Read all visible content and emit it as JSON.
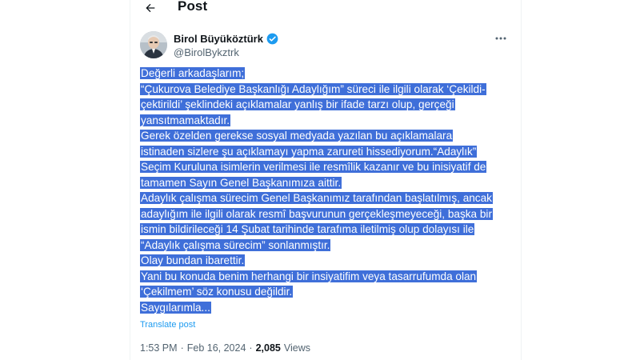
{
  "header": {
    "title": "Post"
  },
  "author": {
    "name": "Birol Büyüköztürk",
    "handle": "@BirolBykztrk"
  },
  "tweet": {
    "lines": [
      "Değerli arkadaşlarım;",
      "“Çukurova Belediye Başkanlığı Adaylığım” süreci ile ilgili olarak ‘Çekildi-",
      "çektirildi’ şeklindeki açıklamalar yanlış bir ifade tarzı olup, gerçeği",
      "yansıtmamaktadır.",
      "Gerek özelden gerekse sosyal medyada yazılan bu açıklamalara",
      "istinaden sizlere şu açıklamayı yapma zarureti hissediyorum.“Adaylık”",
      "Seçim Kuruluna isimlerin verilmesi ile resmîlik kazanır ve bu inisiyatif de",
      "tamamen Sayın Genel Başkanımıza aittir.",
      "Adaylık çalışma sürecim Genel Başkanımız tarafından başlatılmış, ancak",
      "adaylığım ile ilgili olarak resmî başvurunun gerçekleşmeyeceği, başka bir",
      "ismin bildirileceği 14 Şubat tarihinde tarafıma iletilmiş olup dolayısı ile",
      "“Adaylık çalışma sürecim” sonlanmıştır.",
      "Olay bundan ibarettir.",
      "Yani bu konuda benim herhangi bir insiyatifim veya tasarrufumda olan",
      "‘Çekilmem’ söz konusu değildir.",
      "Saygılarımla..."
    ],
    "translate_label": "Translate post"
  },
  "meta": {
    "time": "1:53 PM",
    "date": "Feb 16, 2024",
    "separator": "·",
    "views_count": "2,085",
    "views_label": "Views"
  },
  "colors": {
    "selection": "#3f6fd9",
    "accent": "#1d9bf0",
    "secondary_text": "#536471"
  },
  "icons": {
    "back": "back-arrow-icon",
    "verified": "verified-badge-icon",
    "more": "more-dots-icon"
  }
}
